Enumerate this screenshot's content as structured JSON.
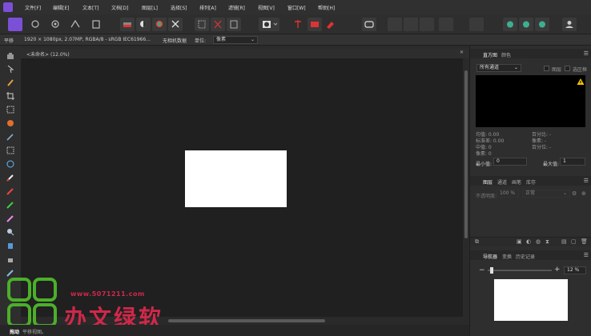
{
  "menu": [
    "文件[F]",
    "编辑[E]",
    "文本[T]",
    "文档[D]",
    "图层[L]",
    "选择[S]",
    "排列[A]",
    "滤镜[R]",
    "视图[V]",
    "窗口[W]",
    "帮助[H]"
  ],
  "context": {
    "tool": "平移",
    "doc_info": "1920 × 1080px, 2.07MP, RGBA/8 - sRGB IEC61966...",
    "metadata": "无相机数据",
    "unit_label": "单位:",
    "unit_value": "像素"
  },
  "document": {
    "tab_title": "<未命名> (12.0%)"
  },
  "status": {
    "hint_label": "拖动",
    "hint_text": "平移视图。"
  },
  "histogram_panel": {
    "tabs": [
      "直方图",
      "颜色"
    ],
    "channel": "所有通道",
    "check_layer": "图层",
    "check_selection": "选区框",
    "stats": {
      "mean": "均值: 0.00",
      "stddev": "标准差: 0.00",
      "median": "中值: 0",
      "pixels": "像素: 0",
      "percentile": "百分比: -",
      "level": "像素: -",
      "cache": "百分位: -"
    },
    "min_label": "最小值:",
    "min_value": "0",
    "max_label": "最大值:",
    "max_value": "1"
  },
  "layers_panel": {
    "tabs": [
      "图层",
      "通道",
      "画笔",
      "库存"
    ],
    "opacity_label": "不透明度:",
    "opacity_value": "100 %",
    "blend_mode": "正常"
  },
  "navigator_panel": {
    "tabs": [
      "导航器",
      "变换",
      "历史记录"
    ],
    "zoom_value": "12 %"
  },
  "watermark": {
    "url": "www.5071211.com",
    "text": "办文绿软"
  },
  "colors": {
    "accent": "#7b4fd6",
    "watermark_red": "#d0284a",
    "watermark_green": "#4caf2a",
    "warning": "#f2c200"
  }
}
